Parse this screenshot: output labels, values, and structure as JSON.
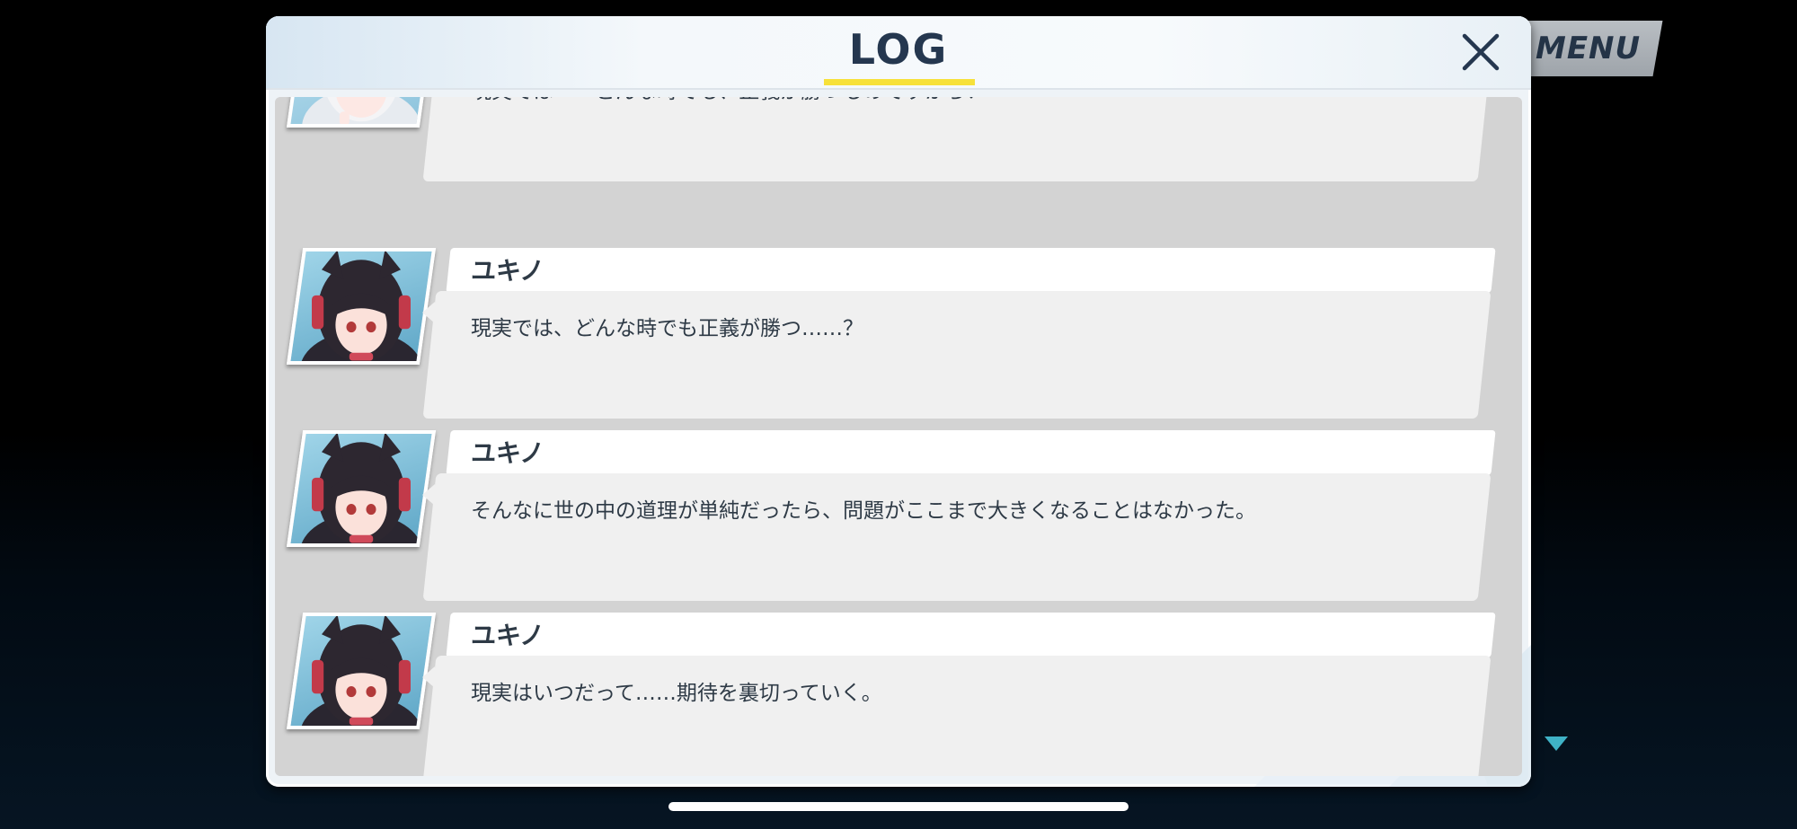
{
  "menu": {
    "label": "MENU"
  },
  "header": {
    "title": "LOG",
    "close_icon": "close-icon"
  },
  "colors": {
    "accent_underline": "#f7e13a",
    "title_text": "#25374f",
    "scroll_indicator": "#3fb2c6"
  },
  "log": {
    "entries": [
      {
        "name": "",
        "text": "現実では――どんな時でも、正義が勝つものですから！",
        "avatar": "white-haired-character-avatar"
      },
      {
        "name": "ユキノ",
        "text": "現実では、どんな時でも正義が勝つ……？",
        "avatar": "yukino-avatar"
      },
      {
        "name": "ユキノ",
        "text": "そんなに世の中の道理が単純だったら、問題がここまで大きくなることはなかった。",
        "avatar": "yukino-avatar"
      },
      {
        "name": "ユキノ",
        "text": "現実はいつだって……期待を裏切っていく。",
        "avatar": "yukino-avatar"
      }
    ]
  },
  "scroll": {
    "icon": "scroll-down-triangle-icon"
  }
}
